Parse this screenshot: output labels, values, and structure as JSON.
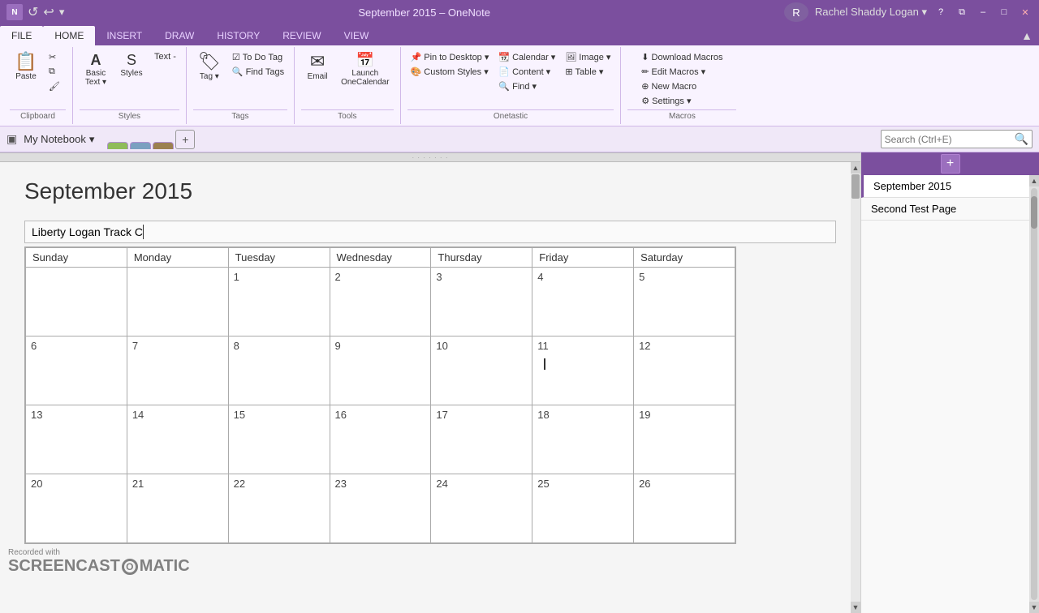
{
  "titleBar": {
    "appName": "September 2015 – OneNote",
    "helpBtn": "?",
    "restoreBtn": "⧉",
    "minimizeBtn": "–",
    "maximizeBtn": "□",
    "closeBtn": "✕"
  },
  "ribbon": {
    "tabs": [
      "FILE",
      "HOME",
      "INSERT",
      "DRAW",
      "HISTORY",
      "REVIEW",
      "VIEW"
    ],
    "activeTab": "HOME",
    "groups": {
      "clipboard": {
        "label": "Clipboard",
        "pasteLabel": "Paste"
      },
      "styles": {
        "label": "Styles",
        "basicTextLabel": "Basic\nText",
        "stylesLabel": "Styles",
        "textLabel": "Text -"
      },
      "tags": {
        "label": "Tags",
        "toDoTagLabel": "To Do Tag",
        "findTagsLabel": "Find Tags",
        "tagLabel": "Tag"
      },
      "tools": {
        "label": "Tools",
        "emailLabel": "Email",
        "launchLabel": "Launch\nOneCalendar"
      },
      "onetastic": {
        "label": "Onetastic",
        "pinDesktopLabel": "Pin to Desktop",
        "customStylesLabel": "Custom Styles",
        "calendarLabel": "Calendar",
        "contentLabel": "Content",
        "findLabel": "Find",
        "imageLabel": "Image",
        "tableLabel": "Table"
      },
      "macros": {
        "label": "Macros",
        "downloadMacrosLabel": "Download Macros",
        "editMacrosLabel": "Edit Macros",
        "newMacroLabel": "New Macro",
        "settingsLabel": "Settings"
      }
    }
  },
  "notebook": {
    "name": "My Notebook",
    "tabs": [
      "",
      "",
      ""
    ],
    "searchPlaceholder": "Search (Ctrl+E)"
  },
  "page": {
    "title": "September 2015",
    "noteTitle": "Liberty Logan Track C|",
    "calendarDays": [
      "Sunday",
      "Monday",
      "Tuesday",
      "Wednesday",
      "Thursday",
      "Friday",
      "Saturday"
    ],
    "calendarWeeks": [
      [
        "",
        "",
        "1",
        "2",
        "3",
        "4",
        "5"
      ],
      [
        "6",
        "7",
        "8",
        "9",
        "10",
        "11",
        "12"
      ],
      [
        "13",
        "14",
        "15",
        "16",
        "17",
        "18",
        "19"
      ],
      [
        "20",
        "21",
        "22",
        "23",
        "24",
        "25",
        "26"
      ]
    ]
  },
  "sidebar": {
    "addBtnLabel": "+",
    "pages": [
      {
        "label": "September 2015",
        "active": true
      },
      {
        "label": "Second Test Page",
        "active": false
      }
    ]
  }
}
